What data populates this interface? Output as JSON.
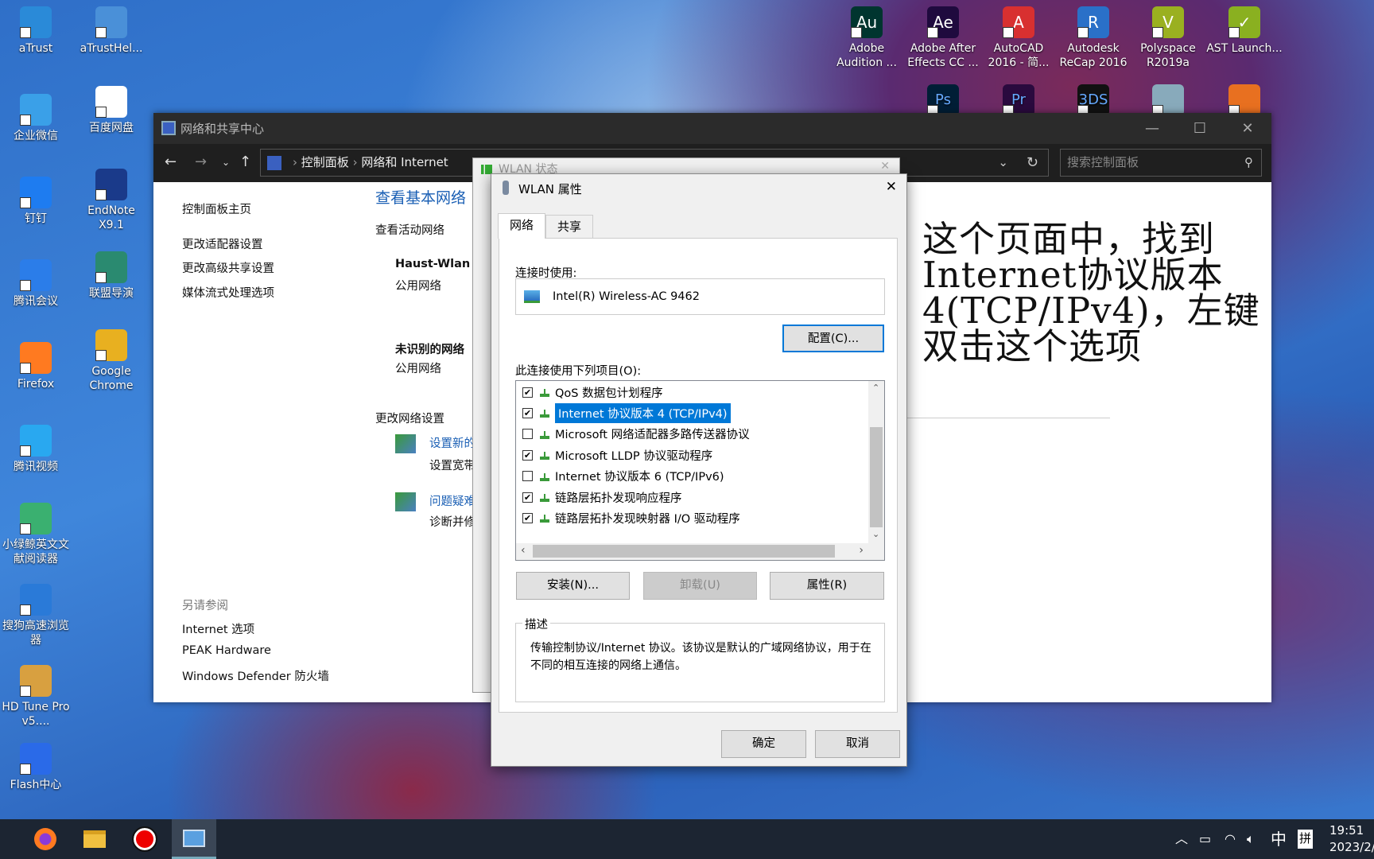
{
  "desktop": {
    "left_icons": [
      {
        "label": "aTrust",
        "color": "#2a8ad8"
      },
      {
        "label": "企业微信",
        "color": "#3aa0e8"
      },
      {
        "label": "钉钉",
        "color": "#1e7cf0"
      },
      {
        "label": "腾讯会议",
        "color": "#2b7de9"
      },
      {
        "label": "Firefox",
        "color": "#ff7a20"
      },
      {
        "label": "腾讯视频",
        "color": "#29a8f0"
      },
      {
        "label": "小绿鲸英文文献阅读器",
        "color": "#3ab070"
      },
      {
        "label": "搜狗高速浏览器",
        "color": "#2a7ad8"
      },
      {
        "label": "HD Tune Pro v5....",
        "color": "#d8a040"
      },
      {
        "label": "Flash中心",
        "color": "#2a6ae8"
      }
    ],
    "col2_icons": [
      {
        "label": "aTrustHel...",
        "color": "#4a90d8"
      },
      {
        "label": "百度网盘",
        "color": "#ffffff"
      },
      {
        "label": "EndNote X9.1",
        "color": "#1a3a8a"
      },
      {
        "label": "联盟导演",
        "color": "#2a8a70"
      },
      {
        "label": "Google Chrome",
        "color": "#e8b020"
      }
    ],
    "top_icons": [
      {
        "label": "Adobe Audition ...",
        "color": "#00352f",
        "glyph": "Au"
      },
      {
        "label": "Adobe After Effects CC ...",
        "color": "#1f0a3e",
        "glyph": "Ae"
      },
      {
        "label": "AutoCAD 2016 - 简...",
        "color": "#d83030",
        "glyph": "A"
      },
      {
        "label": "Autodesk ReCap 2016",
        "color": "#2a70c8",
        "glyph": "R"
      },
      {
        "label": "Polyspace R2019a",
        "color": "#9ab020",
        "glyph": "V"
      },
      {
        "label": "AST Launch...",
        "color": "#8ab020",
        "glyph": "✓"
      }
    ],
    "row2_icons": [
      {
        "glyph": "Ps",
        "color": "#001e36"
      },
      {
        "glyph": "Pr",
        "color": "#2a0a3e"
      },
      {
        "glyph": "3DS",
        "color": "#111"
      },
      {
        "glyph": "",
        "color": "#8ab"
      },
      {
        "glyph": "",
        "color": "#e87020"
      }
    ]
  },
  "network_center": {
    "title": "网络和共享中心",
    "breadcrumb": [
      "控制面板",
      "网络和 Internet"
    ],
    "search_placeholder": "搜索控制面板",
    "sidebar": [
      "控制面板主页",
      "更改适配器设置",
      "更改高级共享设置",
      "媒体流式处理选项"
    ],
    "see_also_title": "另请参阅",
    "see_also": [
      "Internet 选项",
      "PEAK Hardware",
      "Windows Defender 防火墙"
    ],
    "heading": "查看基本网络",
    "active_networks": "查看活动网络",
    "networks": [
      {
        "name": "Haust-Wlan",
        "type": "公用网络"
      },
      {
        "name": "未识别的网络",
        "type": "公用网络"
      }
    ],
    "change_settings": "更改网络设置",
    "tasks": [
      {
        "link": "设置新的",
        "desc": "设置宽带"
      },
      {
        "link": "问题疑难",
        "desc": "诊断并修"
      }
    ]
  },
  "wlan_status": {
    "title": "WLAN 状态"
  },
  "wlan_properties": {
    "title": "WLAN 属性",
    "tabs": [
      "网络",
      "共享"
    ],
    "connect_using_label": "连接时使用:",
    "adapter": "Intel(R) Wireless-AC 9462",
    "configure": "配置(C)...",
    "items_label": "此连接使用下列项目(O):",
    "items": [
      {
        "label": "QoS 数据包计划程序",
        "checked": true,
        "selected": false
      },
      {
        "label": "Internet 协议版本 4 (TCP/IPv4)",
        "checked": true,
        "selected": true
      },
      {
        "label": "Microsoft 网络适配器多路传送器协议",
        "checked": false,
        "selected": false
      },
      {
        "label": "Microsoft LLDP 协议驱动程序",
        "checked": true,
        "selected": false
      },
      {
        "label": "Internet 协议版本 6 (TCP/IPv6)",
        "checked": false,
        "selected": false
      },
      {
        "label": "链路层拓扑发现响应程序",
        "checked": true,
        "selected": false
      },
      {
        "label": "链路层拓扑发现映射器 I/O 驱动程序",
        "checked": true,
        "selected": false
      }
    ],
    "install": "安装(N)...",
    "uninstall": "卸载(U)",
    "properties": "属性(R)",
    "description_label": "描述",
    "description": "传输控制协议/Internet 协议。该协议是默认的广域网络协议，用于在不同的相互连接的网络上通信。",
    "ok": "确定",
    "cancel": "取消"
  },
  "annotation": "这个页面中，找到Internet协议版本4(TCP/IPv4)，左键双击这个选项",
  "taskbar": {
    "clock_time": "19:51",
    "clock_date": "2023/2/",
    "ime": "中",
    "ime_mode": "拼"
  },
  "colors": {
    "selection": "#0078d7",
    "taskbar": "#1c2532"
  }
}
